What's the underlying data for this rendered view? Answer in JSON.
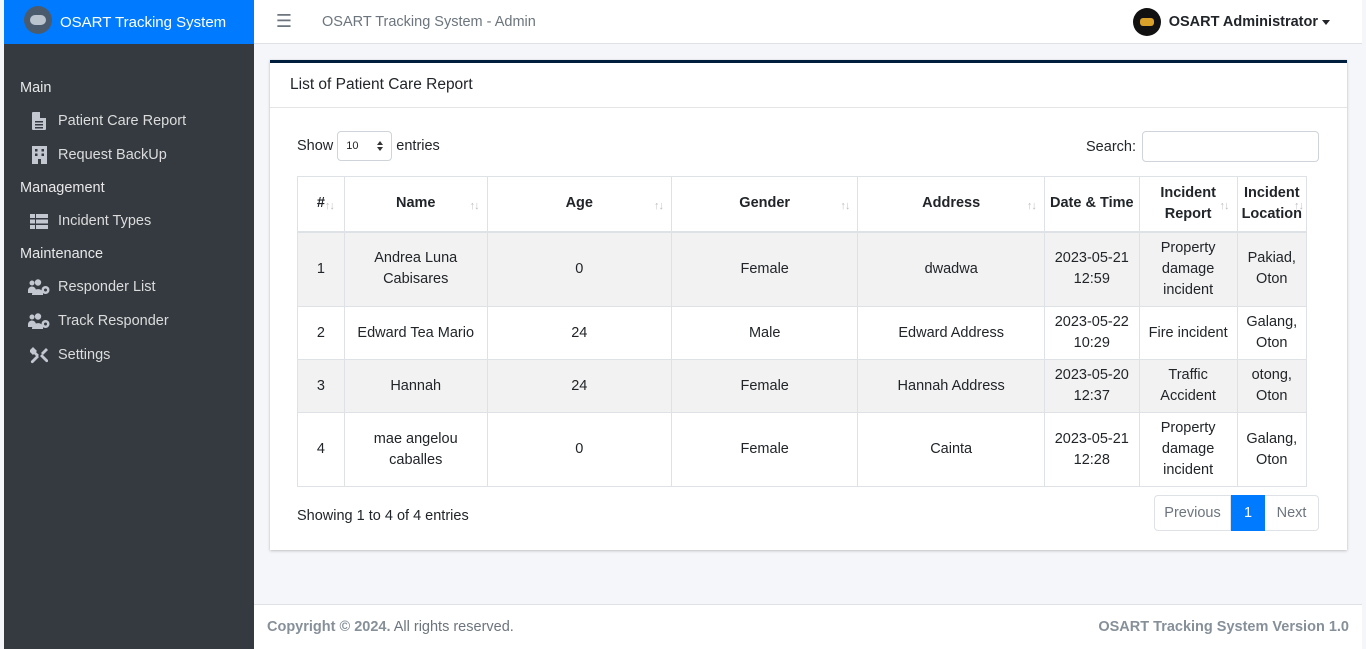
{
  "brand": {
    "name": "OSART Tracking System"
  },
  "topbar": {
    "title": "OSART Tracking System - Admin",
    "user": "OSART Administrator"
  },
  "sidebar": {
    "sections": [
      {
        "header": "Main",
        "items": [
          {
            "label": "Patient Care Report",
            "icon": "file-icon"
          },
          {
            "label": "Request BackUp",
            "icon": "building-icon"
          }
        ]
      },
      {
        "header": "Management",
        "items": [
          {
            "label": "Incident Types",
            "icon": "list-icon"
          }
        ]
      },
      {
        "header": "Maintenance",
        "items": [
          {
            "label": "Responder List",
            "icon": "users-cog-icon"
          },
          {
            "label": "Track Responder",
            "icon": "users-cog-icon"
          },
          {
            "label": "Settings",
            "icon": "tools-icon"
          }
        ]
      }
    ]
  },
  "card": {
    "title": "List of Patient Care Report",
    "show_label": "Show",
    "entries_label": "entries",
    "page_length": "10",
    "search_label": "Search:",
    "search_value": ""
  },
  "table": {
    "columns": [
      "#",
      "Name",
      "Age",
      "Gender",
      "Address",
      "Date & Time",
      "Incident Report",
      "Incident Location"
    ],
    "rows": [
      {
        "num": "1",
        "name": "Andrea Luna Cabisares",
        "age": "0",
        "gender": "Female",
        "address": "dwadwa",
        "datetime": "2023-05-21 12:59",
        "report": "Property damage incident",
        "location": "Pakiad, Oton"
      },
      {
        "num": "2",
        "name": "Edward Tea Mario",
        "age": "24",
        "gender": "Male",
        "address": "Edward Address",
        "datetime": "2023-05-22 10:29",
        "report": "Fire incident",
        "location": "Galang, Oton"
      },
      {
        "num": "3",
        "name": "Hannah",
        "age": "24",
        "gender": "Female",
        "address": "Hannah Address",
        "datetime": "2023-05-20 12:37",
        "report": "Traffic Accident",
        "location": "otong, Oton"
      },
      {
        "num": "4",
        "name": "mae angelou caballes",
        "age": "0",
        "gender": "Female",
        "address": "Cainta",
        "datetime": "2023-05-21 12:28",
        "report": "Property damage incident",
        "location": "Galang, Oton"
      }
    ]
  },
  "pagination": {
    "info": "Showing 1 to 4 of 4 entries",
    "previous": "Previous",
    "current": "1",
    "next": "Next"
  },
  "footer": {
    "copyright": "Copyright © 2024.",
    "rights": " All rights reserved.",
    "version": "OSART Tracking System Version 1.0"
  },
  "colors": {
    "brand_blue": "#007bff",
    "sidebar_bg": "#343a40",
    "card_top": "#001f3f"
  }
}
